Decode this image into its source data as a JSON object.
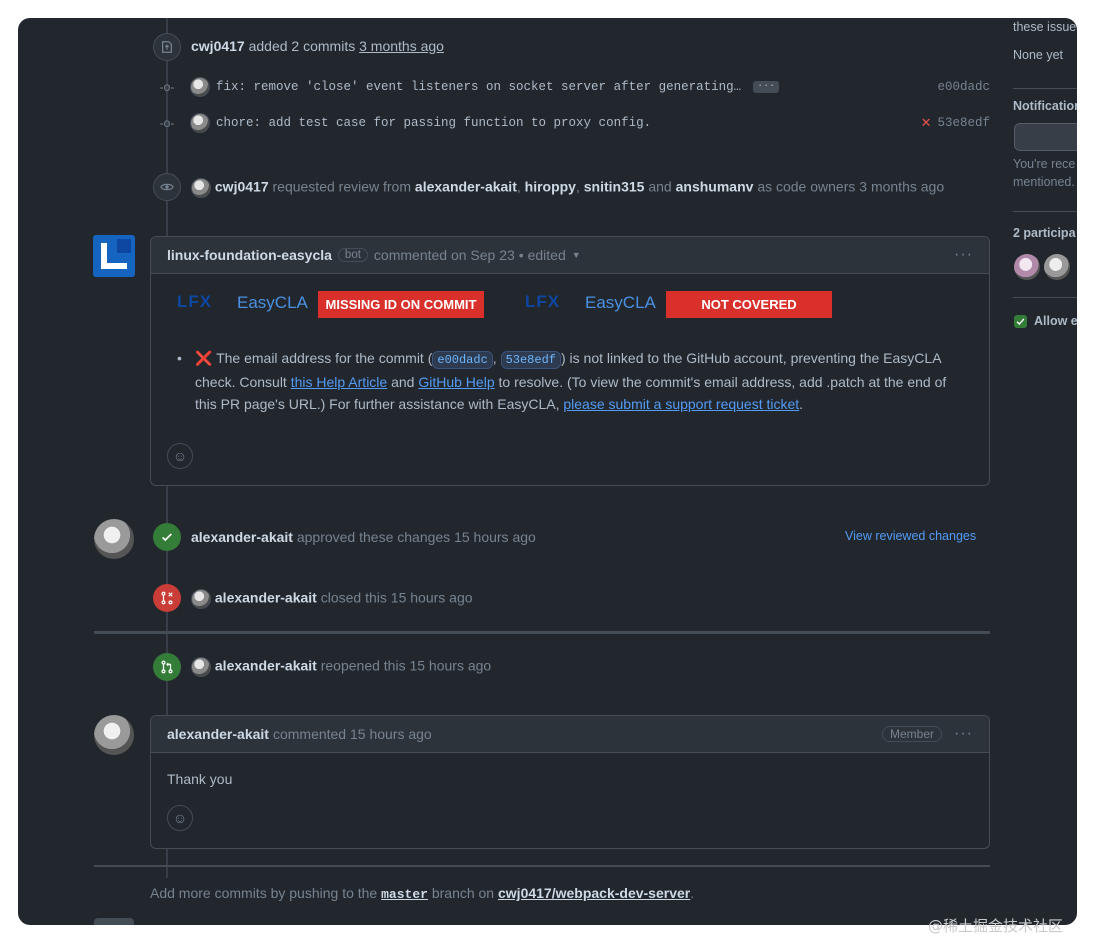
{
  "commits_event": {
    "actor": "cwj0417",
    "action": "added 2 commits",
    "time": "3 months ago",
    "commits": [
      {
        "message": "fix: remove 'close' event listeners on socket server after generating…",
        "more": "···",
        "status": "",
        "sha": "e00dadc"
      },
      {
        "message": "chore: add test case for passing function to proxy config.",
        "more": "",
        "status": "✕",
        "sha": "53e8edf"
      }
    ]
  },
  "review_request": {
    "actor": "cwj0417",
    "text_1": "requested review from",
    "reviewers": [
      "alexander-akait",
      "hiroppy",
      "snitin315"
    ],
    "text_and": "and",
    "last_reviewer": "anshumanv",
    "text_2": "as code owners",
    "time": "3 months ago"
  },
  "cla_comment": {
    "author": "linux-foundation-easycla",
    "bot_label": "bot",
    "meta": "commented on Sep 23",
    "edited": "• edited",
    "menu": "···",
    "logo_text": "EasyCLA",
    "badge_1": "MISSING ID ON COMMIT",
    "badge_2": "NOT COVERED",
    "cross": "❌",
    "body_1": "The email address for the commit (",
    "sha_1": "e00dadc",
    "comma": ",",
    "sha_2": "53e8edf",
    "body_2": ") is not linked to the GitHub account, preventing the EasyCLA",
    "body_3": "check. Consult",
    "link_1": "this Help Article",
    "body_4": "and",
    "link_2": "GitHub Help",
    "body_5": "to resolve. (To view the commit's email address, add .patch at the end",
    "body_6": "of this PR page's URL.) For further assistance with EasyCLA,",
    "link_3": "please submit a support request ticket",
    "period": ".",
    "emoji": "☺"
  },
  "approval": {
    "actor": "alexander-akait",
    "text": "approved these changes",
    "time": "15 hours ago",
    "view_link": "View reviewed changes"
  },
  "closed_event": {
    "actor": "alexander-akait",
    "text": "closed this",
    "time": "15 hours ago"
  },
  "reopened_event": {
    "actor": "alexander-akait",
    "text": "reopened this",
    "time": "15 hours ago"
  },
  "member_comment": {
    "author": "alexander-akait",
    "meta": "commented 15 hours ago",
    "role": "Member",
    "menu": "···",
    "body": "Thank you",
    "emoji": "☺"
  },
  "footer": {
    "text_1": "Add more commits by pushing to the",
    "branch": "master",
    "text_2": "branch on",
    "repo": "cwj0417/webpack-dev-server",
    "period": "."
  },
  "sidebar": {
    "issues_text": "these issue",
    "none_yet": "None yet",
    "notifications_title": "Notification",
    "receiving_line_1": "You're rece",
    "receiving_line_2": "mentioned.",
    "participants": "2 participa",
    "allow_edits": "Allow e"
  },
  "watermark": "@稀土掘金技术社区"
}
